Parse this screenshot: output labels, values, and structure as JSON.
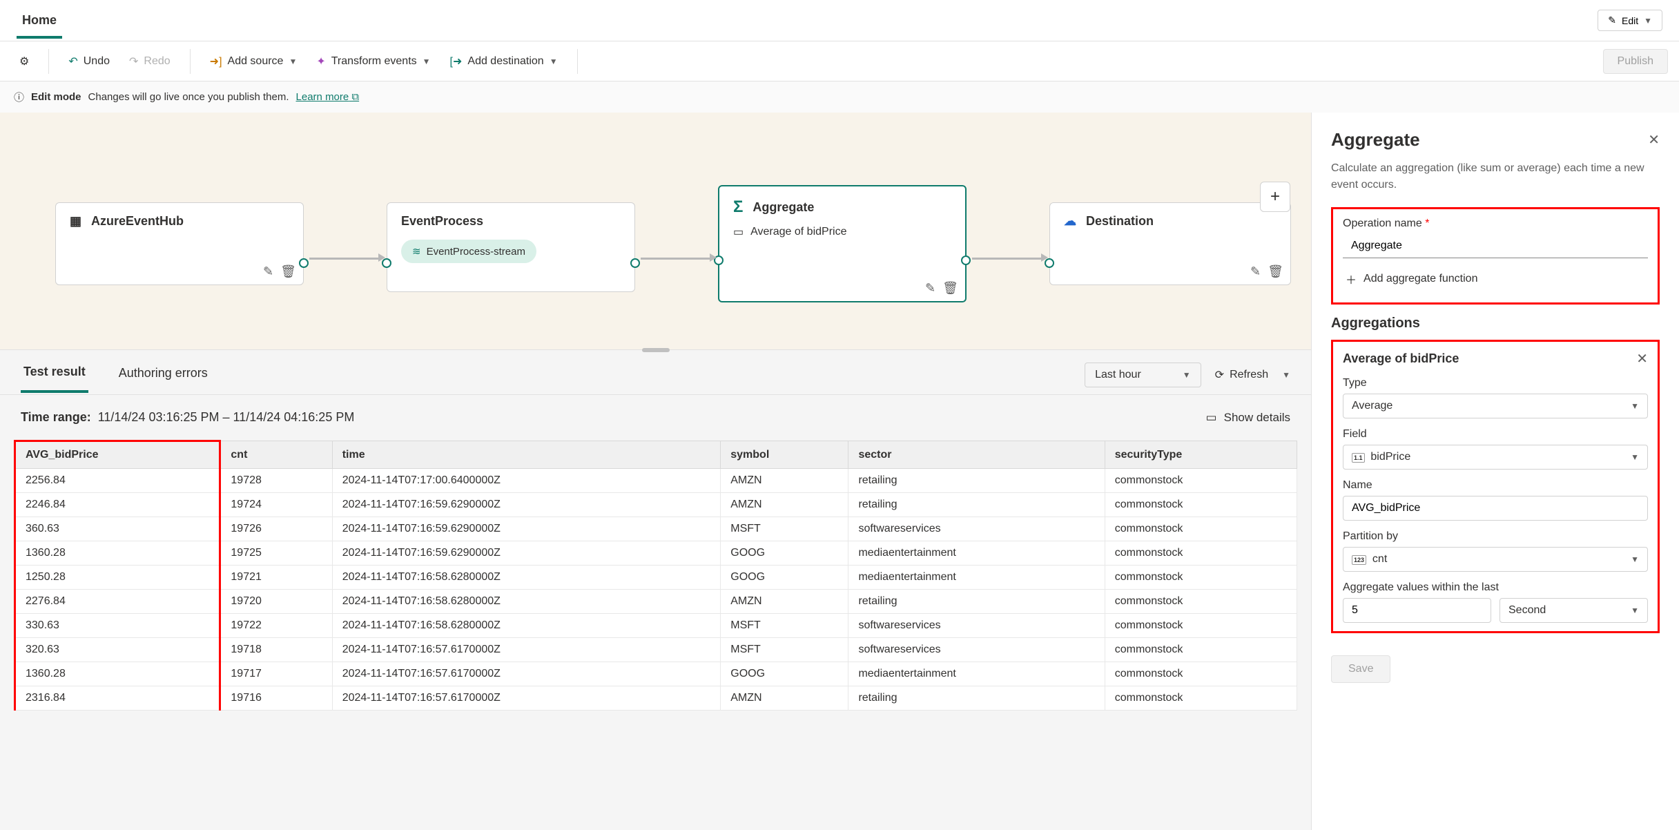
{
  "tabs": {
    "home": "Home"
  },
  "topbar": {
    "edit": "Edit"
  },
  "toolbar": {
    "undo": "Undo",
    "redo": "Redo",
    "add_source": "Add source",
    "transform": "Transform events",
    "add_dest": "Add destination",
    "settings": "Settings",
    "publish": "Publish"
  },
  "infobar": {
    "mode": "Edit mode",
    "msg": "Changes will go live once you publish them.",
    "learn": "Learn more"
  },
  "nodes": {
    "source": {
      "title": "AzureEventHub"
    },
    "process": {
      "title": "EventProcess",
      "stream": "EventProcess-stream"
    },
    "agg": {
      "title": "Aggregate",
      "sub": "Average of bidPrice"
    },
    "dest": {
      "title": "Destination"
    }
  },
  "results": {
    "tab_test": "Test result",
    "tab_err": "Authoring errors",
    "time_sel": "Last hour",
    "refresh": "Refresh",
    "range_label": "Time range:",
    "range_val": "11/14/24 03:16:25 PM  –  11/14/24 04:16:25 PM",
    "show_details": "Show details",
    "cols": [
      "AVG_bidPrice",
      "cnt",
      "time",
      "symbol",
      "sector",
      "securityType"
    ],
    "rows": [
      [
        "2256.84",
        "19728",
        "2024-11-14T07:17:00.6400000Z",
        "AMZN",
        "retailing",
        "commonstock"
      ],
      [
        "2246.84",
        "19724",
        "2024-11-14T07:16:59.6290000Z",
        "AMZN",
        "retailing",
        "commonstock"
      ],
      [
        "360.63",
        "19726",
        "2024-11-14T07:16:59.6290000Z",
        "MSFT",
        "softwareservices",
        "commonstock"
      ],
      [
        "1360.28",
        "19725",
        "2024-11-14T07:16:59.6290000Z",
        "GOOG",
        "mediaentertainment",
        "commonstock"
      ],
      [
        "1250.28",
        "19721",
        "2024-11-14T07:16:58.6280000Z",
        "GOOG",
        "mediaentertainment",
        "commonstock"
      ],
      [
        "2276.84",
        "19720",
        "2024-11-14T07:16:58.6280000Z",
        "AMZN",
        "retailing",
        "commonstock"
      ],
      [
        "330.63",
        "19722",
        "2024-11-14T07:16:58.6280000Z",
        "MSFT",
        "softwareservices",
        "commonstock"
      ],
      [
        "320.63",
        "19718",
        "2024-11-14T07:16:57.6170000Z",
        "MSFT",
        "softwareservices",
        "commonstock"
      ],
      [
        "1360.28",
        "19717",
        "2024-11-14T07:16:57.6170000Z",
        "GOOG",
        "mediaentertainment",
        "commonstock"
      ],
      [
        "2316.84",
        "19716",
        "2024-11-14T07:16:57.6170000Z",
        "AMZN",
        "retailing",
        "commonstock"
      ]
    ]
  },
  "panel": {
    "title": "Aggregate",
    "desc": "Calculate an aggregation (like sum or average) each time a new event occurs.",
    "op_label": "Operation name",
    "op_val": "Aggregate",
    "add_fn": "Add aggregate function",
    "aggs_h": "Aggregations",
    "agg_title": "Average of bidPrice",
    "type_l": "Type",
    "type_v": "Average",
    "field_l": "Field",
    "field_v": "bidPrice",
    "name_l": "Name",
    "name_v": "AVG_bidPrice",
    "part_l": "Partition by",
    "part_v": "cnt",
    "win_l": "Aggregate values within the last",
    "win_v": "5",
    "win_u": "Second",
    "save": "Save"
  }
}
